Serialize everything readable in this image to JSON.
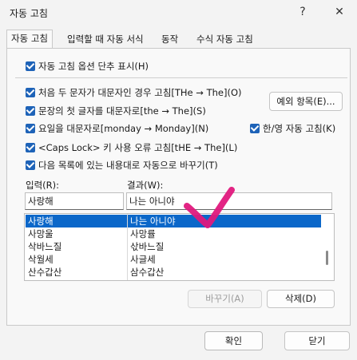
{
  "window": {
    "title": "자동 고침",
    "help_label": "?",
    "close_label": "✕"
  },
  "tabs": [
    {
      "label": "자동 고침",
      "active": true
    },
    {
      "label": "입력할 때 자동 서식",
      "active": false
    },
    {
      "label": "동작",
      "active": false
    },
    {
      "label": "수식 자동 고침",
      "active": false
    }
  ],
  "options": {
    "show_buttons": "자동 고침 옵션 단추 표시(H)",
    "two_initial_caps": "처음 두 문자가 대문자인 경우 고침[THe → The](O)",
    "first_letter_sentence": "문장의 첫 글자를 대문자로[the → The](S)",
    "day_names": "요일을 대문자로[monday → Monday](N)",
    "caps_lock": "<Caps Lock> 키 사용 오류 고침[tHE → The](L)",
    "replace_text": "다음 목록에 있는 내용대로 자동으로 바꾸기(T)",
    "hangul_english": "한/영 자동 고침(K)"
  },
  "buttons": {
    "exceptions": "예외 항목(E)...",
    "replace": "바꾸기(A)",
    "delete": "삭제(D)",
    "ok": "확인",
    "close": "닫기"
  },
  "fields": {
    "input_label": "입력(R):",
    "result_label": "결과(W):",
    "input_value": "사랑해",
    "result_value": "나는 아니야"
  },
  "list": {
    "rows": [
      {
        "input": "사랑해",
        "result": "나는 아니야",
        "selected": true
      },
      {
        "input": "사망울",
        "result": "사망률",
        "selected": false
      },
      {
        "input": "삭바느질",
        "result": "삯바느질",
        "selected": false
      },
      {
        "input": "삭월세",
        "result": "사글세",
        "selected": false
      },
      {
        "input": "산수갑산",
        "result": "삼수갑산",
        "selected": false
      }
    ]
  },
  "colors": {
    "accent": "#1e63b8",
    "selection": "#0b67c9",
    "annotation": "#e0197d"
  }
}
